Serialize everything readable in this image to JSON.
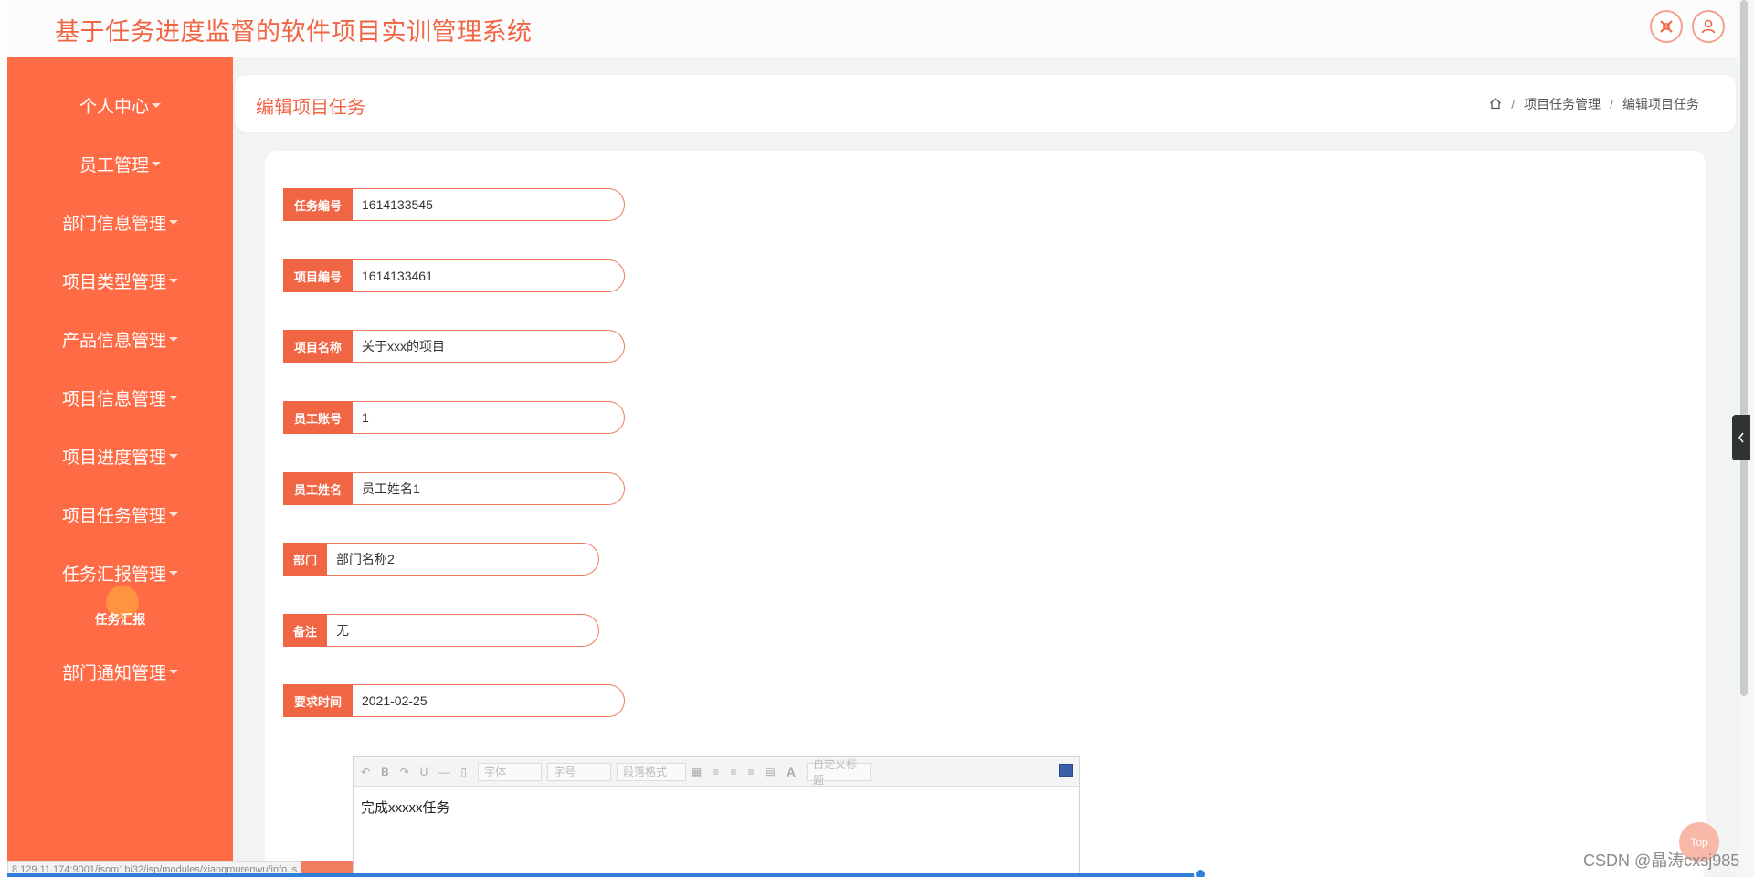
{
  "app": {
    "title": "基于任务进度监督的软件项目实训管理系统"
  },
  "header": {
    "fullscreen_icon": "fullscreen-exit-icon",
    "user_icon": "user-icon"
  },
  "sidebar": {
    "items": [
      {
        "label": "个人中心"
      },
      {
        "label": "员工管理"
      },
      {
        "label": "部门信息管理"
      },
      {
        "label": "项目类型管理"
      },
      {
        "label": "产品信息管理"
      },
      {
        "label": "项目信息管理"
      },
      {
        "label": "项目进度管理"
      },
      {
        "label": "项目任务管理"
      },
      {
        "label": "任务汇报管理"
      },
      {
        "label": "部门通知管理"
      }
    ],
    "sub_item": {
      "label": "任务汇报"
    }
  },
  "page": {
    "title": "编辑项目任务",
    "breadcrumb": [
      "项目任务管理",
      "编辑项目任务"
    ]
  },
  "form": {
    "task_no": {
      "label": "任务编号",
      "value": "1614133545"
    },
    "project_no": {
      "label": "项目编号",
      "value": "1614133461"
    },
    "project_name": {
      "label": "项目名称",
      "value": "关于xxx的项目"
    },
    "employee_account": {
      "label": "员工账号",
      "value": "1"
    },
    "employee_name": {
      "label": "员工姓名",
      "value": "员工姓名1"
    },
    "department": {
      "label": "部门",
      "value": "部门名称2"
    },
    "remark": {
      "label": "备注",
      "value": "无"
    },
    "required_time": {
      "label": "要求时间",
      "value": "2021-02-25"
    }
  },
  "editor": {
    "font_select": "字体",
    "size_select": "字号",
    "paragraph_select": "段落格式",
    "custom_title_select": "自定义标题",
    "content": "完成xxxxx任务"
  },
  "status_bar": {
    "url": "8.129.11.174:9001/isom1bi32/isp/modules/xiangmurenwu/info.js"
  },
  "top_button": {
    "label": "Top"
  },
  "watermark": "CSDN @晶涛cxsj985",
  "colors": {
    "accent": "#f06544",
    "sidebar": "#ff6b45"
  }
}
